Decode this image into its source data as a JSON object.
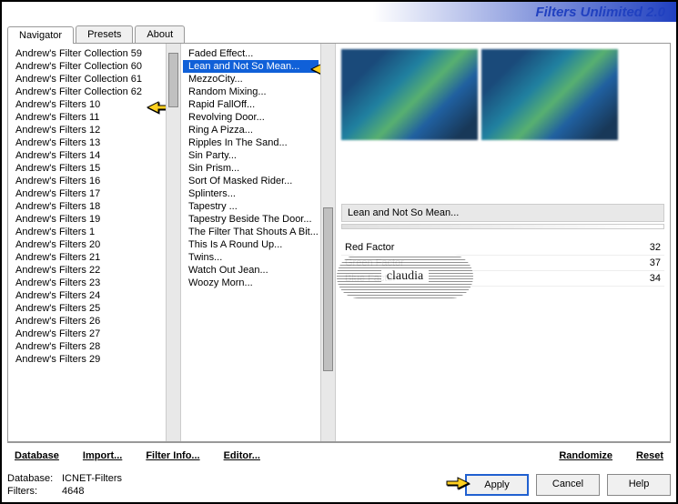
{
  "title": "Filters Unlimited 2.0",
  "tabs": [
    "Navigator",
    "Presets",
    "About"
  ],
  "activeTab": 0,
  "categories": [
    "Andrew's Filter Collection 59",
    "Andrew's Filter Collection 60",
    "Andrew's Filter Collection 61",
    "Andrew's Filter Collection 62",
    "Andrew's Filters 10",
    "Andrew's Filters 11",
    "Andrew's Filters 12",
    "Andrew's Filters 13",
    "Andrew's Filters 14",
    "Andrew's Filters 15",
    "Andrew's Filters 16",
    "Andrew's Filters 17",
    "Andrew's Filters 18",
    "Andrew's Filters 19",
    "Andrew's Filters 1",
    "Andrew's Filters 20",
    "Andrew's Filters 21",
    "Andrew's Filters 22",
    "Andrew's Filters 23",
    "Andrew's Filters 24",
    "Andrew's Filters 25",
    "Andrew's Filters 26",
    "Andrew's Filters 27",
    "Andrew's Filters 28",
    "Andrew's Filters 29"
  ],
  "selectedCategoryIndex": 4,
  "filters": [
    "Faded Effect...",
    "Lean and Not So Mean...",
    "MezzoCity...",
    "Random Mixing...",
    "Rapid FallOff...",
    "Revolving Door...",
    "Ring A Pizza...",
    "Ripples In The Sand...",
    "Sin Party...",
    "Sin Prism...",
    "Sort Of Masked Rider...",
    "Splinters...",
    "Tapestry ...",
    "Tapestry Beside The Door...",
    "The Filter That Shouts A Bit...",
    "This Is A Round Up...",
    "Twins...",
    "Watch Out Jean...",
    "Woozy Morn..."
  ],
  "selectedFilterIndex": 1,
  "currentFilterName": "Lean and Not So Mean...",
  "params": [
    {
      "label": "Red Factor",
      "value": "32"
    },
    {
      "label": "Green Factor",
      "value": "37"
    },
    {
      "label": "Blue Factor",
      "value": "34"
    }
  ],
  "toolbar": {
    "database": "Database",
    "import": "Import...",
    "filterInfo": "Filter Info...",
    "editor": "Editor...",
    "randomize": "Randomize",
    "reset": "Reset"
  },
  "buttons": {
    "apply": "Apply",
    "cancel": "Cancel",
    "help": "Help"
  },
  "status": {
    "dbLabel": "Database:",
    "dbValue": "ICNET-Filters",
    "filtersLabel": "Filters:",
    "filtersValue": "4648"
  },
  "watermark": "claudia"
}
